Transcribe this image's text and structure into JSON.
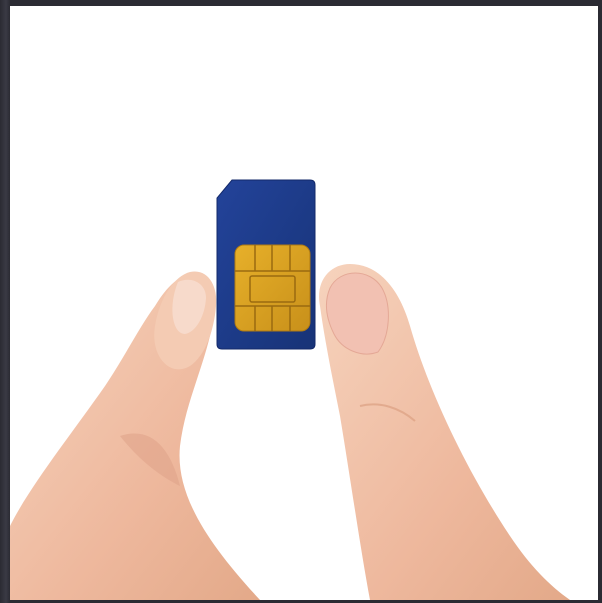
{
  "image": {
    "subject": "",
    "colors": {
      "frame": "#2a2a30",
      "background": "#ffffff",
      "sim_body": "#1e3a8a",
      "chip": "#d4a017",
      "skin": "#f2c7ad"
    }
  }
}
